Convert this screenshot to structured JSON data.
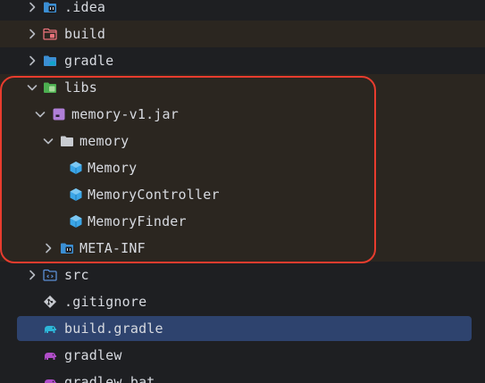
{
  "tree": {
    "items": [
      {
        "label": ".idea",
        "icon": "folder-config-icon"
      },
      {
        "label": "build",
        "icon": "folder-build-icon"
      },
      {
        "label": "gradle",
        "icon": "folder-gradle-icon"
      },
      {
        "label": "libs",
        "icon": "folder-libs-icon"
      },
      {
        "label": "memory-v1.jar",
        "icon": "jar-icon"
      },
      {
        "label": "memory",
        "icon": "package-icon"
      },
      {
        "label": "Memory",
        "icon": "class-icon"
      },
      {
        "label": "MemoryController",
        "icon": "class-icon"
      },
      {
        "label": "MemoryFinder",
        "icon": "class-icon"
      },
      {
        "label": "META-INF",
        "icon": "folder-meta-icon"
      },
      {
        "label": "src",
        "icon": "folder-src-icon"
      },
      {
        "label": ".gitignore",
        "icon": "git-icon"
      },
      {
        "label": "build.gradle",
        "icon": "gradle-elephant-icon"
      },
      {
        "label": "gradlew",
        "icon": "gradle-elephant-icon"
      },
      {
        "label": "gradlew.bat",
        "icon": "gradle-elephant-icon"
      }
    ]
  },
  "colors": {
    "background": "#1e1f22",
    "highlight_row": "#2b2620",
    "selection": "#2e436e",
    "focus_outline": "#e83c2e",
    "class_icon": "#3ba6e8",
    "jar_icon": "#b07fd8"
  }
}
